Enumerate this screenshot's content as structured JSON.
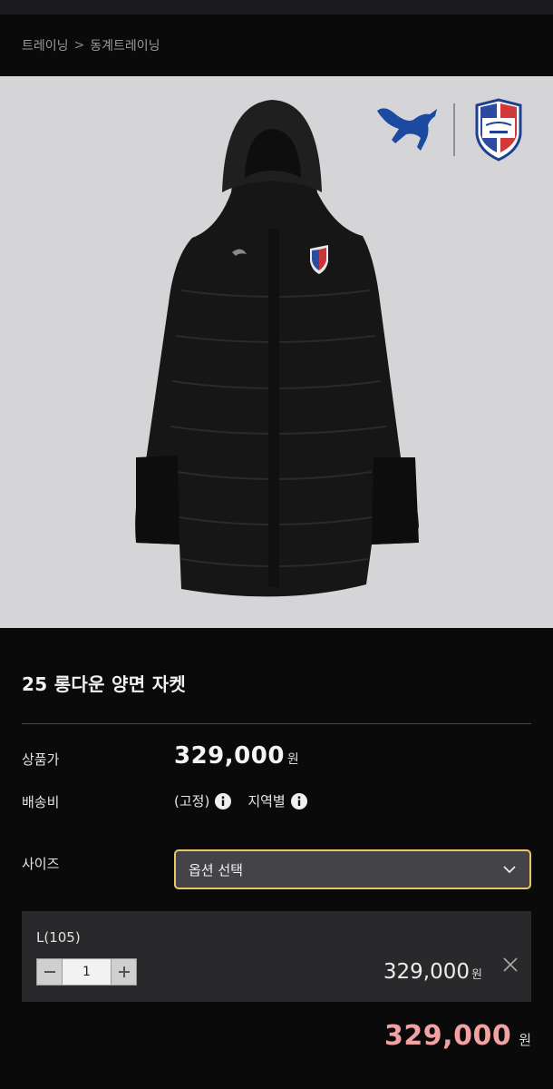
{
  "breadcrumb": {
    "items": [
      "트레이닝",
      "동계트레이닝"
    ],
    "separator": ">"
  },
  "product": {
    "title": "25 롱다운 양면 자켓",
    "image_alt": "black long down jacket with PUMA and Suwon Bluewings logos"
  },
  "price_row": {
    "label": "상품가",
    "value": "329,000",
    "unit": "원"
  },
  "shipping_row": {
    "label": "배송비",
    "fixed": "(고정)",
    "regional": "지역별"
  },
  "size_row": {
    "label": "사이즈",
    "select_value": "옵션 선택"
  },
  "selected_option": {
    "name": "L(105)",
    "quantity": "1",
    "price": "329,000",
    "unit": "원"
  },
  "total": {
    "value": "329,000",
    "unit": "원"
  },
  "colors": {
    "accent_border": "#e8c766",
    "total_price": "#f2a2a2",
    "background": "#0a0a0a"
  },
  "icons": [
    "info-icon",
    "chevron-down-icon",
    "minus-icon",
    "plus-icon",
    "close-icon",
    "puma-logo",
    "club-crest"
  ]
}
